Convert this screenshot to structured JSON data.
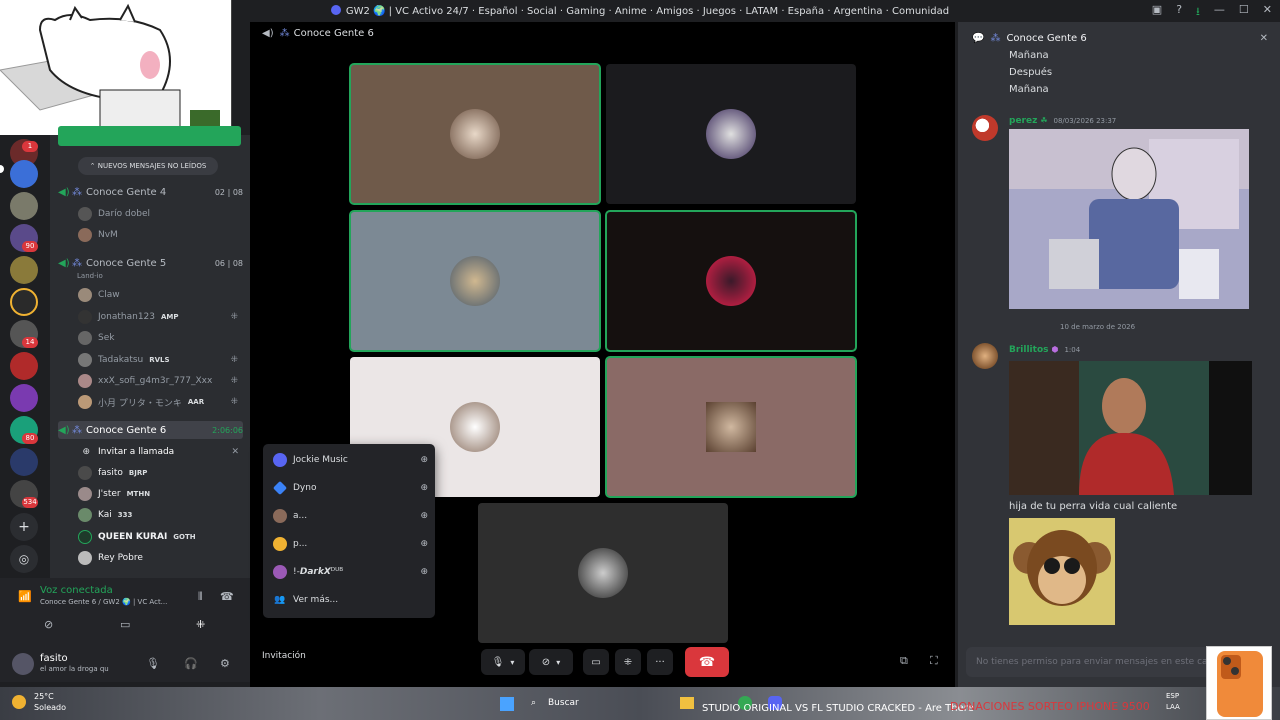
{
  "window": {
    "title": "GW2 🌍 | VC Activo 24/7 · Español · Social · Gaming · Anime · Amigos · Juegos · LATAM · España · Argentina · Comunidad"
  },
  "rail": {
    "badges": [
      "1",
      "90",
      "14",
      "80",
      "534"
    ]
  },
  "sidebar": {
    "unread_banner": "NUEVOS MENSAJES NO LEÍDOS",
    "channels": [
      {
        "name": "Conoce Gente 4",
        "time_a": "02",
        "time_b": "08"
      },
      {
        "name": "Conoce Gente 5",
        "time_a": "06",
        "time_b": "08",
        "status": "Land-io"
      },
      {
        "name": "Conoce Gente 6",
        "timer": "2:06:06"
      }
    ],
    "members_vc4": [
      "Darío dobel",
      "NvM"
    ],
    "members_vc5": [
      {
        "name": "Claw",
        "tag": ""
      },
      {
        "name": "Jonathan123",
        "tag": "AMP"
      },
      {
        "name": "Sek",
        "tag": ""
      },
      {
        "name": "Tadakatsu",
        "tag": "RVLS"
      },
      {
        "name": "xxX_sofi_g4m3r_777_Xxx",
        "tag": ""
      },
      {
        "name": "小月 プリタ・モンキ",
        "tag": "AAR"
      }
    ],
    "invite_label": "Invitar a llamada",
    "members_vc6": [
      {
        "name": "fasito",
        "tag": "BJRP"
      },
      {
        "name": "J'ster",
        "tag": "MTHN"
      },
      {
        "name": "Kai",
        "tag": "333"
      },
      {
        "name": "QUEEN KURAI",
        "tag": "GOTH"
      },
      {
        "name": "Rey Pobre",
        "tag": ""
      }
    ]
  },
  "voice": {
    "status": "Voz conectada",
    "path": "Conoce Gente 6 / GW2 🌍 | VC Act..."
  },
  "user": {
    "name": "fasito",
    "status": "el amor la droga qu"
  },
  "stage": {
    "channel": "Conoce Gente 6",
    "invite_button": "Invitación"
  },
  "popup": {
    "items": [
      {
        "name": "Jockie Music",
        "color": "#5865f2"
      },
      {
        "name": "Dyno",
        "color": "#3b82f6"
      },
      {
        "name": "a...",
        "color": "#8a6a5a"
      },
      {
        "name": "p...",
        "color": "#f0b232"
      },
      {
        "name": "!-𝘿𝙖𝙧𝙠𝙓ᴰᵁᴮ",
        "color": "#9b59b6"
      }
    ],
    "more": "Ver más..."
  },
  "chat": {
    "title": "Conoce Gente 6",
    "lines_top": [
      "Mañana",
      "Después",
      "Mañana"
    ],
    "msg1": {
      "author": "perez",
      "time": "08/03/2026 23:37",
      "author_color": "#23a55a"
    },
    "date_separator": "10 de marzo de 2026",
    "msg2": {
      "author": "Brillitos",
      "time": "1:04",
      "author_color": "#23a55a",
      "text": "hija de tu perra vida cual caliente"
    },
    "input_placeholder": "No tienes permiso para enviar mensajes en este canal."
  },
  "taskbar": {
    "weather_temp": "25°C",
    "weather_desc": "Soleado",
    "search": "Buscar",
    "ticker": "STUDIO ORIGINAL VS FL STUDIO CRACKED - Are There",
    "promo": "DONACIONES SORTEO IPHONE 9500",
    "lang": "ESP",
    "lang2": "LAA"
  }
}
